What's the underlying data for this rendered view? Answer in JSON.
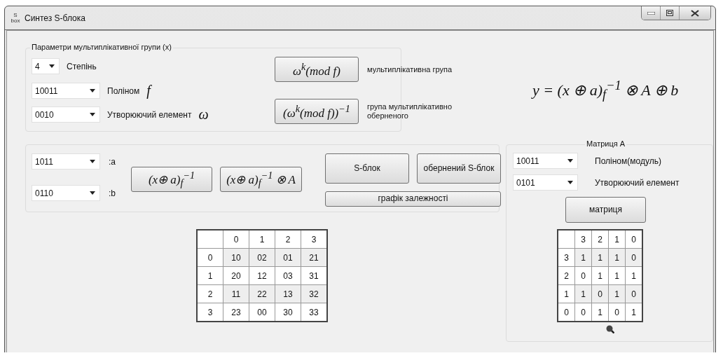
{
  "window": {
    "title": "Синтез S-блока",
    "icon_text": "S\nbox"
  },
  "group_multiplicative": {
    "title": "Параметри мультиплікативної групи (x)",
    "fields": [
      {
        "kind": "short",
        "value": "4",
        "label": "Степінь"
      },
      {
        "kind": "long",
        "value": "10011",
        "label": "Поліном",
        "symbol": "f"
      },
      {
        "kind": "long",
        "value": "0010",
        "label": "Утворюючий елемент",
        "symbol": "ω"
      }
    ],
    "actions": [
      {
        "formula": "ω$^{k}$(mod f)",
        "caption": "мультиплікативна група"
      },
      {
        "formula": "(ω$^{k}$(mod f))$^{−1}$",
        "caption": "група мультиплікативно оберненого"
      }
    ]
  },
  "main_formula": "y = (x ⊕ a)$_{f}$$^{−1}$ ⊗ A ⊕ b",
  "group_sbox": {
    "fields": [
      {
        "value": "1011",
        "label": ":a"
      },
      {
        "value": "0110",
        "label": ":b"
      }
    ],
    "formula_buttons": [
      "(x⊕ a)$_{f}$$^{−1}$",
      "(x⊕ a)$_{f}$$^{−1}$ ⊗ A"
    ],
    "buttons": [
      "S-блок",
      "обернений S-блок"
    ],
    "wide_button": "графік залежності"
  },
  "sbox_table": {
    "columns": [
      "0",
      "1",
      "2",
      "3"
    ],
    "rows": [
      {
        "header": "0",
        "cells": [
          "10",
          "02",
          "01",
          "21"
        ]
      },
      {
        "header": "1",
        "cells": [
          "20",
          "12",
          "03",
          "31"
        ]
      },
      {
        "header": "2",
        "cells": [
          "11",
          "22",
          "13",
          "32"
        ]
      },
      {
        "header": "3",
        "cells": [
          "23",
          "00",
          "30",
          "33"
        ]
      }
    ]
  },
  "matrix_group": {
    "title": "Матриця A",
    "fields": [
      {
        "value": "10011",
        "label": "Поліном(модуль)"
      },
      {
        "value": "0101",
        "label": "Утворюючий елемент"
      }
    ],
    "button": "матриця",
    "table": {
      "columns": [
        "3",
        "2",
        "1",
        "0"
      ],
      "rows": [
        {
          "header": "3",
          "cells": [
            "1",
            "1",
            "1",
            "0"
          ]
        },
        {
          "header": "2",
          "cells": [
            "0",
            "1",
            "1",
            "1"
          ]
        },
        {
          "header": "1",
          "cells": [
            "1",
            "0",
            "1",
            "0"
          ]
        },
        {
          "header": "0",
          "cells": [
            "0",
            "1",
            "0",
            "1"
          ]
        }
      ]
    }
  }
}
